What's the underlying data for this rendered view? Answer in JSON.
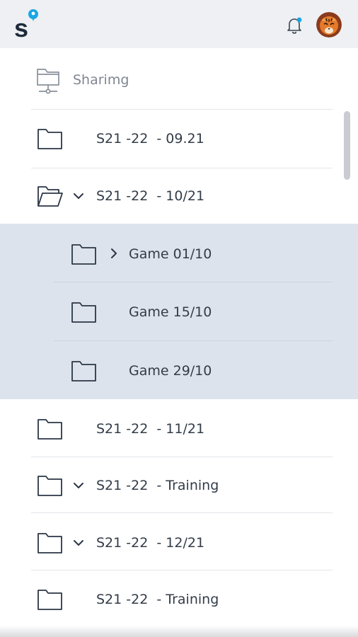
{
  "header": {
    "logo_icon": "sportzy-s-logo",
    "notification_icon": "bell-icon",
    "notification_dot_color": "#1aa6e4",
    "avatar_icon": "tiger-avatar"
  },
  "sharing": {
    "label": "Sharimg",
    "icon": "shared-folder-network-icon"
  },
  "folders": [
    {
      "label": "S21 -22  - 09.21",
      "expanded": false,
      "has_chevron": false
    },
    {
      "label": "S21 -22  - 10/21",
      "expanded": true,
      "has_chevron": true,
      "children": [
        {
          "label": "Game 01/10",
          "has_chevron": true,
          "chevron": "right"
        },
        {
          "label": "Game 15/10",
          "has_chevron": false
        },
        {
          "label": "Game 29/10",
          "has_chevron": false
        }
      ]
    },
    {
      "label": "S21 -22  - 11/21",
      "expanded": false,
      "has_chevron": false
    },
    {
      "label": "S21 -22  - Training",
      "expanded": false,
      "has_chevron": true
    },
    {
      "label": "S21 -22  - 12/21",
      "expanded": false,
      "has_chevron": true
    },
    {
      "label": "S21 -22  - Training",
      "expanded": false,
      "has_chevron": false
    }
  ],
  "colors": {
    "header_bg": "#eef0f3",
    "selected_bg": "#dde3ec",
    "text": "#323c48",
    "icon_stroke": "#2b3645",
    "logo_dot": "#1aa6e4"
  }
}
